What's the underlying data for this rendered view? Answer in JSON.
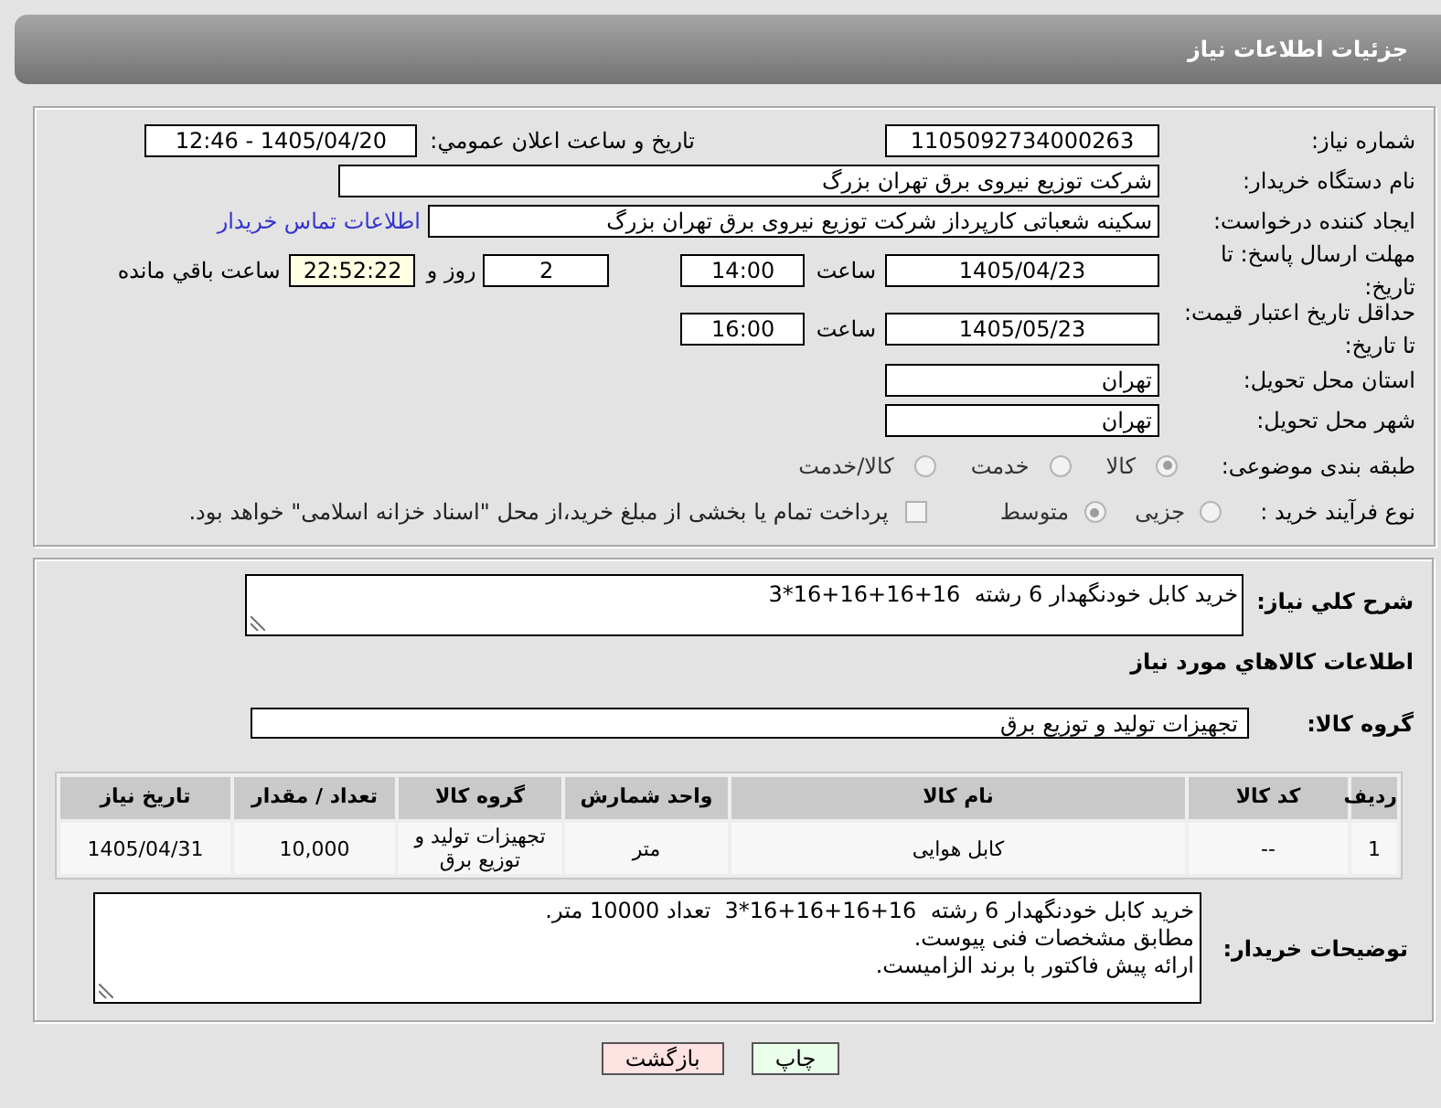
{
  "header": {
    "title": "جزئیات اطلاعات نیاز"
  },
  "details": {
    "need_number": {
      "label": "شماره نیاز:",
      "value": "1105092734000263"
    },
    "announcement": {
      "label": "تاریخ و ساعت اعلان عمومي:",
      "value": "1405/04/20 - 12:46"
    },
    "buyer": {
      "label": "نام دستگاه خریدار:",
      "value": "شرکت توزیع نیروی برق تهران بزرگ"
    },
    "requester": {
      "label": "ایجاد کننده درخواست:",
      "value": "سکینه شعباتی کارپرداز شرکت توزیع نیروی برق تهران بزرگ",
      "contact_link": "اطلاعات تماس خریدار"
    },
    "response_deadline": {
      "label": "مهلت ارسال پاسخ: تا تاریخ:",
      "date": "1405/04/23",
      "time_label": "ساعت",
      "time": "14:00",
      "days": "2",
      "days_label": "روز و",
      "remaining": "22:52:22",
      "remaining_label": "ساعت باقي مانده"
    },
    "price_validity": {
      "label": "حداقل تاریخ اعتبار قیمت: تا تاریخ:",
      "date": "1405/05/23",
      "time_label": "ساعت",
      "time": "16:00"
    },
    "province": {
      "label": "استان محل تحویل:",
      "value": "تهران"
    },
    "city": {
      "label": "شهر محل تحویل:",
      "value": "تهران"
    },
    "category": {
      "label": "طبقه بندی موضوعی:",
      "options": [
        {
          "label": "کالا",
          "selected": true
        },
        {
          "label": "خدمت",
          "selected": false
        },
        {
          "label": "کالا/خدمت",
          "selected": false
        }
      ]
    },
    "purchase_type": {
      "label": "نوع فرآیند خرید :",
      "options": [
        {
          "label": "جزیی",
          "selected": false
        },
        {
          "label": "متوسط",
          "selected": true
        }
      ],
      "treasury_payment": {
        "label": "پرداخت تمام یا بخشی از مبلغ خرید،از محل \"اسناد خزانه اسلامی\" خواهد بود.",
        "checked": false
      }
    }
  },
  "goods": {
    "summary": {
      "label": "شرح کلي نياز:",
      "value": "خرید کابل خودنگهدار 6 رشته  16+16+16+16*3"
    },
    "heading": "اطلاعات کالاهاي مورد نياز",
    "group": {
      "label": "گروه کالا:",
      "value": "تجهیزات تولید و توزیع برق"
    },
    "table": {
      "columns": [
        "ردیف",
        "کد کالا",
        "نام کالا",
        "واحد شمارش",
        "گروه کالا",
        "تعداد / مقدار",
        "تاریخ نیاز"
      ],
      "rows": [
        [
          "1",
          "--",
          "کابل هوایی",
          "متر",
          "تجهیزات تولید و توزیع برق",
          "10,000",
          "1405/04/31"
        ]
      ]
    },
    "buyer_notes": {
      "label": "توضیحات خریدار:",
      "value": "خرید کابل خودنگهدار 6 رشته  16+16+16+16*3  تعداد 10000 متر.\nمطابق مشخصات فنی پیوست.\nارائه پیش فاکتور با برند الزامیست."
    }
  },
  "buttons": [
    {
      "label": "چاپ",
      "kind": "print"
    },
    {
      "label": "بازگشت",
      "kind": "back"
    }
  ]
}
